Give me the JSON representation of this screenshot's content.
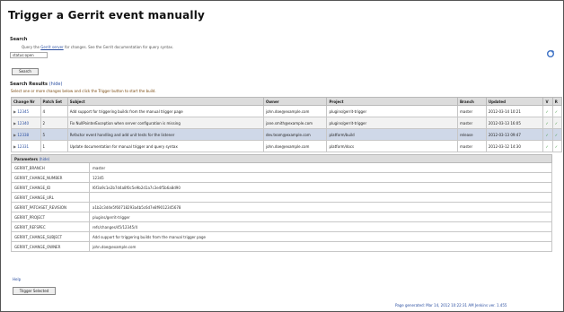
{
  "page": {
    "title": "Trigger a Gerrit event manually"
  },
  "search": {
    "label": "Search",
    "help_prefix": "Query the",
    "help_link": "Gerrit server",
    "help_suffix": "for changes. See the Gerrit documentation for query syntax.",
    "input_value": "status:open",
    "button_label": "Search"
  },
  "results": {
    "label": "Search Results",
    "toggle_link": "(hide)",
    "info": "Select one or more changes below and click the Trigger button to start the build.",
    "columns": [
      "Change Nr",
      "Patch Set",
      "Subject",
      "Owner",
      "Project",
      "Branch",
      "Updated",
      "V",
      "R"
    ],
    "rows": [
      {
        "change": "12345",
        "patch": "4",
        "subject": "Add support for triggering builds from the manual trigger page",
        "owner": "john.doe@example.com",
        "project": "plugins/gerrit-trigger",
        "branch": "master",
        "updated": "2012-03-14 10:21",
        "v": "✓",
        "r": "✓"
      },
      {
        "change": "12340",
        "patch": "2",
        "subject": "Fix NullPointerException when server configuration is missing",
        "owner": "jane.smith@example.com",
        "project": "plugins/gerrit-trigger",
        "branch": "master",
        "updated": "2012-03-13 16:05",
        "v": "✓",
        "r": "✓"
      },
      {
        "change": "12338",
        "patch": "5",
        "subject": "Refactor event handling and add unit tests for the listener",
        "owner": "dev.team@example.com",
        "project": "platform/build",
        "branch": "release",
        "updated": "2012-03-13 09:47",
        "v": "✓",
        "r": "✓"
      },
      {
        "change": "12331",
        "patch": "1",
        "subject": "Update documentation for manual trigger and query syntax",
        "owner": "john.doe@example.com",
        "project": "platform/docs",
        "branch": "master",
        "updated": "2012-03-12 14:30",
        "v": "✓",
        "r": "✓"
      }
    ]
  },
  "parameters": {
    "label": "Parameters",
    "toggle_link": "(hide)",
    "rows": [
      {
        "name": "GERRIT_BRANCH",
        "value": "master"
      },
      {
        "name": "GERRIT_CHANGE_NUMBER",
        "value": "12345"
      },
      {
        "name": "GERRIT_CHANGE_ID",
        "value": "I6f3a9c1e2b7d4a8f0c5e9b2d1a7c3e4f5b6a8d90"
      },
      {
        "name": "GERRIT_CHANGE_URL",
        "value": ""
      },
      {
        "name": "GERRIT_PATCHSET_REVISION",
        "value": "a1b2c3d4e5f60718293a4b5c6d7e8f9012345678"
      },
      {
        "name": "GERRIT_PROJECT",
        "value": "plugins/gerrit-trigger"
      },
      {
        "name": "GERRIT_REFSPEC",
        "value": "refs/changes/45/12345/4"
      },
      {
        "name": "GERRIT_CHANGE_SUBJECT",
        "value": "Add support for triggering builds from the manual trigger page"
      },
      {
        "name": "GERRIT_CHANGE_OWNER",
        "value": "john.doe@example.com"
      }
    ]
  },
  "bottom": {
    "link": "Help",
    "trigger_button": "Trigger Selected"
  },
  "footer": {
    "text": "Page generated: Mar 14, 2012 10:22:31 AM   Jenkins ver. 1.455"
  },
  "icons": {
    "refresh": "refresh-icon"
  },
  "colors": {
    "link": "#2a4ea0",
    "check": "#2f8f2f",
    "header_bg": "#dcdcdc"
  }
}
